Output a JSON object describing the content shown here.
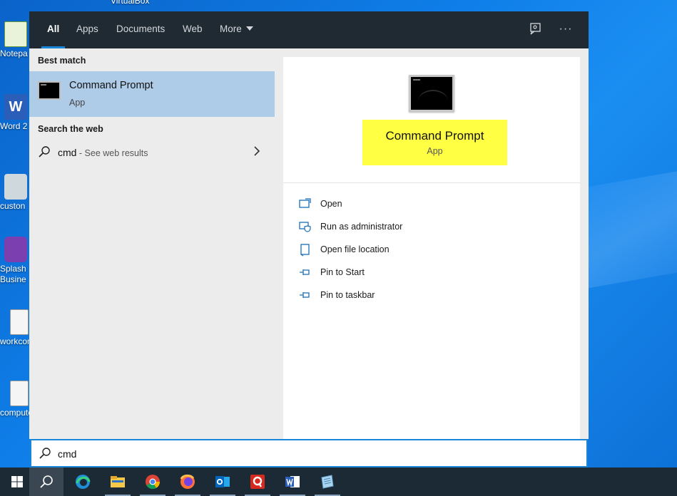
{
  "desktop": {
    "top_label": "VirtualBox",
    "icons": [
      {
        "label": "Notepa",
        "name": "notepad-icon"
      },
      {
        "label": "Word 2",
        "name": "word-icon"
      },
      {
        "label": "custon",
        "name": "custom-app-icon"
      },
      {
        "label": "Splash Busine",
        "name": "splashtop-icon"
      },
      {
        "label": "workcon",
        "name": "document-icon"
      },
      {
        "label": "compute",
        "name": "document-icon"
      }
    ]
  },
  "search_panel": {
    "tabs": [
      "All",
      "Apps",
      "Documents",
      "Web",
      "More"
    ],
    "active_tab": "All",
    "best_match_heading": "Best match",
    "best_match": {
      "title": "Command Prompt",
      "subtitle": "App"
    },
    "web_heading": "Search the web",
    "web_result": {
      "query": "cmd",
      "suffix": " - See web results"
    },
    "detail": {
      "title": "Command Prompt",
      "subtitle": "App",
      "actions": [
        {
          "label": "Open",
          "icon": "open-icon"
        },
        {
          "label": "Run as administrator",
          "icon": "shield-icon"
        },
        {
          "label": "Open file location",
          "icon": "folder-location-icon"
        },
        {
          "label": "Pin to Start",
          "icon": "pin-icon"
        },
        {
          "label": "Pin to taskbar",
          "icon": "pin-icon"
        }
      ]
    }
  },
  "search_box": {
    "value": "cmd"
  },
  "taskbar": {
    "items": [
      "start",
      "search",
      "edge",
      "file-explorer",
      "chrome",
      "firefox",
      "outlook",
      "quickbooks",
      "word",
      "notepad"
    ]
  },
  "colors": {
    "accent": "#1a86d8",
    "highlight": "#ffff43",
    "selected_row": "#aecbe8",
    "topbar": "#1f2a33",
    "taskbar": "#1c2a36"
  }
}
